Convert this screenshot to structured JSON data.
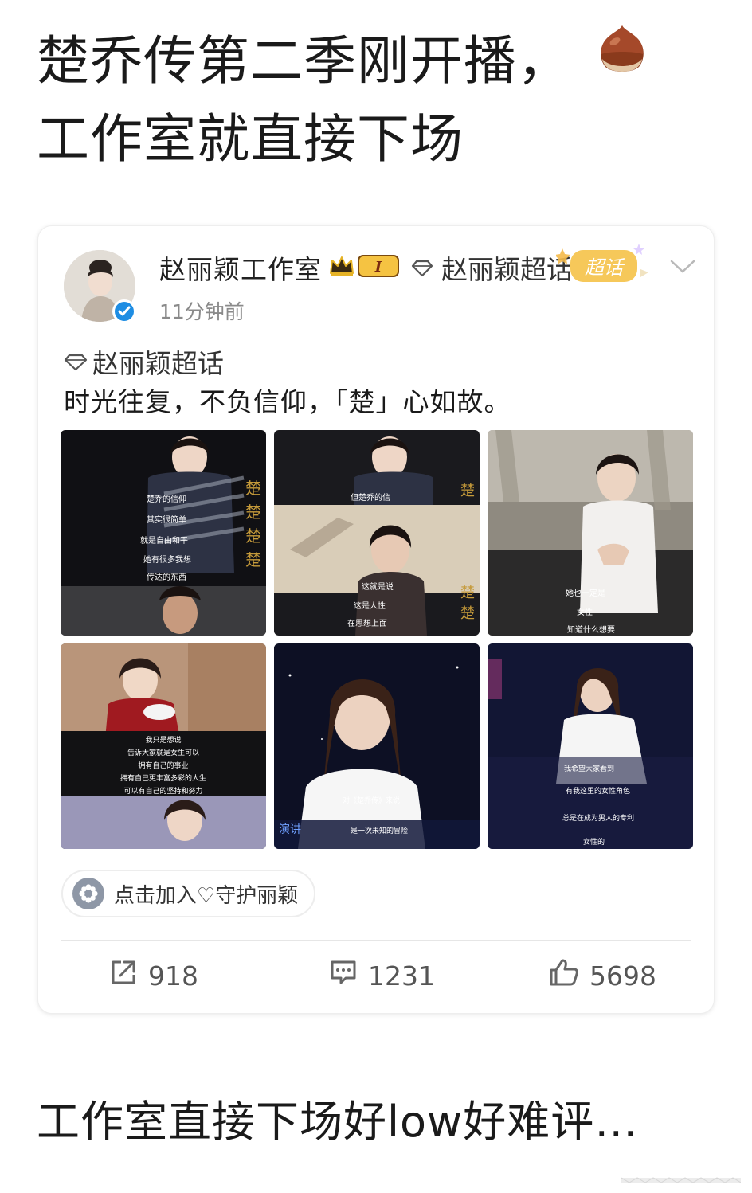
{
  "headline": {
    "line1": "楚乔传第二季刚开播，",
    "line2": "工作室就直接下场",
    "emoji_icon": "chestnut-icon"
  },
  "post": {
    "author": "赵丽颖工作室",
    "level_badge": "I",
    "topic_link": "赵丽颖超话",
    "super_badge": "超话",
    "time": "11分钟前",
    "topic_tag": "赵丽颖超话",
    "text": "时光往复，不负信仰，「楚」心如故。",
    "join_label": "点击加入♡守护丽颖",
    "repost_count": "918",
    "comment_count": "1231",
    "like_count": "5698"
  },
  "photos": [
    {
      "bg": "#101014",
      "subtitles": [
        "楚乔的信仰",
        "其实很简单",
        "就是自由和平",
        "她有很多我想",
        "传达的东西"
      ],
      "subtitle_color": "#ffffff"
    },
    {
      "bg": "#1a1a1e",
      "subtitles": [
        "但楚乔的信",
        "这就是说",
        "这是人性",
        "在思想上面"
      ],
      "subtitle_color": "#ffffff"
    },
    {
      "bg": "#8f8a80",
      "subtitles": [
        "她也一定是",
        "女性",
        "知道什么想要"
      ],
      "subtitle_color": "#ffffff"
    },
    {
      "bg": "#2a2426",
      "subtitles": [
        "我只是想说",
        "告诉大家就是女生可以",
        "拥有自己的事业",
        "拥有自己更丰富多彩的人生",
        "可以有自己的坚持和努力"
      ],
      "subtitle_color": "#ffffff"
    },
    {
      "bg": "#0d1024",
      "subtitles": [
        "对《楚乔传》来说",
        "是一次未知的冒险"
      ],
      "subtitle_color": "#ffffff",
      "stage_text": "演讲"
    },
    {
      "bg": "#121634",
      "subtitles": [
        "我希望大家看到",
        "有我这里的女性角色",
        "总是在成为男人的专利",
        "女性的"
      ],
      "subtitle_color": "#ffffff"
    }
  ],
  "bottom_text": "工作室直接下场好low好难评…",
  "colors": {
    "verified": "#1e8de3",
    "badge_gold": "#f5c342",
    "super_badge": "#f6c85a",
    "text_dark": "#1a1a1a",
    "text_gray": "#8a8a8a"
  }
}
